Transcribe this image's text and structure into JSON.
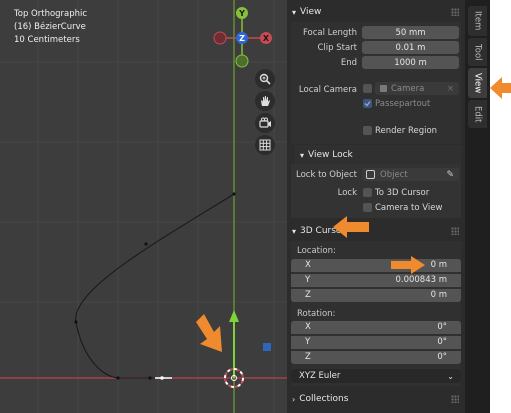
{
  "viewport": {
    "info": [
      "Top Orthographic",
      "(16) BézierCurve",
      "10 Centimeters"
    ]
  },
  "gizmo": {
    "y_label": "Y",
    "z_label": "Z",
    "x_label": "X"
  },
  "side_tabs": [
    "Item",
    "Tool",
    "View",
    "Edit"
  ],
  "view": {
    "title": "View",
    "focal_length_label": "Focal Length",
    "focal_length": "50 mm",
    "clip_start_label": "Clip Start",
    "clip_start": "0.01 m",
    "end_label": "End",
    "end": "1000 m",
    "local_camera_label": "Local Camera",
    "camera_placeholder": "Camera",
    "passepartout": "Passepartout",
    "render_region": "Render Region"
  },
  "view_lock": {
    "title": "View Lock",
    "lock_to_object_label": "Lock to Object",
    "object_placeholder": "Object",
    "lock_label": "Lock",
    "to_3d_cursor": "To 3D Cursor",
    "camera_to_view": "Camera to View"
  },
  "cursor": {
    "title": "3D Cursor",
    "location_label": "Location:",
    "location": [
      {
        "axis": "X",
        "value": "0 m"
      },
      {
        "axis": "Y",
        "value": "0.000843 m"
      },
      {
        "axis": "Z",
        "value": "0 m"
      }
    ],
    "rotation_label": "Rotation:",
    "rotation": [
      {
        "axis": "X",
        "value": "0°"
      },
      {
        "axis": "Y",
        "value": "0°"
      },
      {
        "axis": "Z",
        "value": "0°"
      }
    ],
    "rotation_mode": "XYZ Euler"
  },
  "collections": {
    "title": "Collections"
  },
  "colors": {
    "accent": "#4772b3",
    "annotation_arrow": "#f08a2e",
    "x_axis": "#c94a52",
    "y_axis": "#84c23c"
  }
}
